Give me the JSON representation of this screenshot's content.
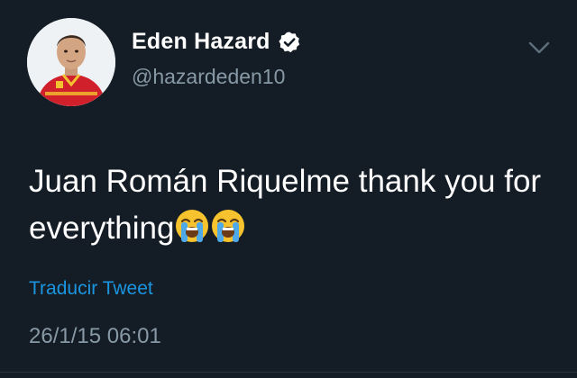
{
  "user": {
    "display_name": "Eden Hazard",
    "handle": "@hazardeden10",
    "verified": true,
    "avatar_icon": "profile-photo"
  },
  "tweet": {
    "text": "Juan Román Riquelme thank you for everything",
    "emojis": [
      "loudly-crying-face",
      "loudly-crying-face"
    ]
  },
  "actions": {
    "translate_label": "Traducir Tweet",
    "menu_icon": "chevron-down-icon"
  },
  "meta": {
    "timestamp": "26/1/15 06:01"
  },
  "colors": {
    "background": "#141d26",
    "accent": "#1b95e0",
    "secondary_text": "#8899a6"
  }
}
